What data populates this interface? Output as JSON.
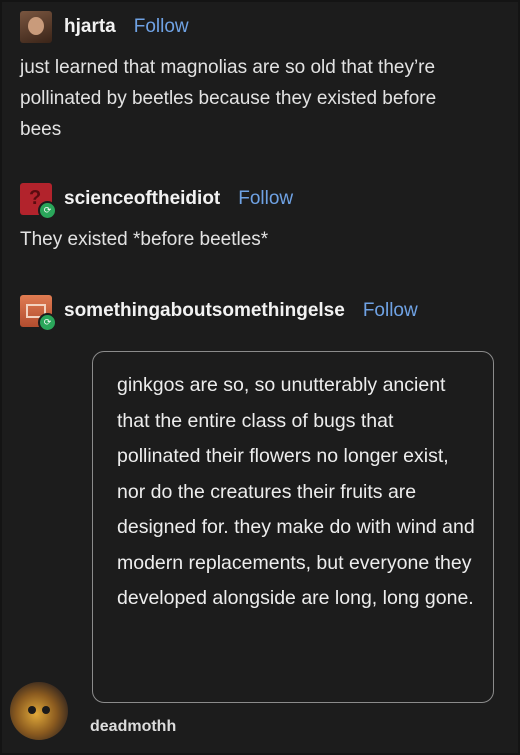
{
  "posts": [
    {
      "username": "hjarta",
      "follow": "Follow",
      "text": "just learned that magnolias are so old that they’re pollinated by beetles because they existed before bees"
    },
    {
      "username": "scienceoftheidiot",
      "follow": "Follow",
      "text": "They existed *before beetles*"
    },
    {
      "username": "somethingaboutsomethingelse",
      "follow": "Follow"
    }
  ],
  "quote": "ginkgos are so, so unutterably ancient that the entire class of bugs that pollinated their flowers no longer exist, nor do the creatures their fruits are designed for. they make do with wind and modern replacements, but everyone they developed alongside are long, long gone.",
  "footer": {
    "username": "deadmothh"
  },
  "colors": {
    "background": "#1c1c1c",
    "follow": "#6fa2e4",
    "text": "#e2e2e2",
    "reblog_badge": "#2aa65a"
  }
}
